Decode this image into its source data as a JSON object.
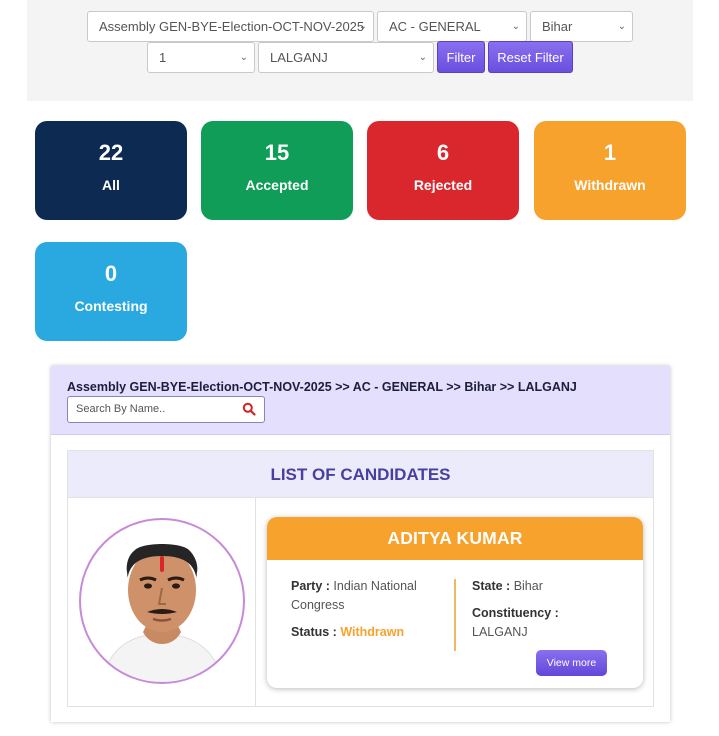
{
  "filters": {
    "election": "Assembly GEN-BYE-Election-OCT-NOV-2025",
    "constituency_type": "AC - GENERAL",
    "state": "Bihar",
    "ac_number": "1",
    "constituency": "LALGANJ",
    "filter_label": "Filter",
    "reset_label": "Reset Filter"
  },
  "summary": [
    {
      "count": "22",
      "label": "All",
      "color": "#0d2b52"
    },
    {
      "count": "15",
      "label": "Accepted",
      "color": "#0f9d58"
    },
    {
      "count": "6",
      "label": "Rejected",
      "color": "#d9272d"
    },
    {
      "count": "1",
      "label": "Withdrawn",
      "color": "#f7a22c"
    },
    {
      "count": "0",
      "label": "Contesting",
      "color": "#2aa9e0"
    }
  ],
  "list": {
    "breadcrumb": "Assembly GEN-BYE-Election-OCT-NOV-2025 >> AC - GENERAL >> Bihar >> LALGANJ",
    "search_placeholder": "Search By Name..",
    "title": "LIST OF CANDIDATES"
  },
  "candidate": {
    "name": "ADITYA KUMAR",
    "party_label": "Party :",
    "party": "Indian National Congress",
    "status_label": "Status :",
    "status": "Withdrawn",
    "status_color": "#f7a22c",
    "state_label": "State :",
    "state": "Bihar",
    "constituency_label": "Constituency :",
    "constituency": "LALGANJ",
    "view_more": "View more"
  }
}
